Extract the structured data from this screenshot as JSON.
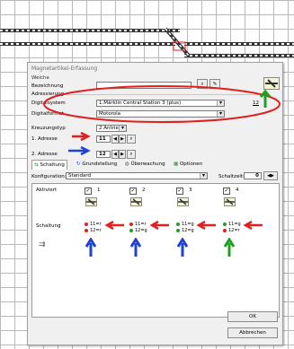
{
  "dialog": {
    "title": "Magnetartikel-Erfassung",
    "weiche_label": "Weiche",
    "bezeichnung_label": "Bezeichnung",
    "adressierung_label": "Adressierung",
    "digitalsystem_label": "Digitalsystem",
    "digitalsystem_value": "1.Märklin Central Station 3 (plus)",
    "digitalformat_label": "Digitalformat",
    "digitalformat_value": "Motorola",
    "kreuzungstyp_label": "Kreuzungstyp",
    "kreuzungstyp_value": "2 Antriebe",
    "adresse1_label": "1. Adresse",
    "adresse1_value": "11",
    "adresse2_label": "2. Adresse",
    "adresse2_value": "12",
    "help_number": "12"
  },
  "tabs": [
    {
      "label": "Schaltung"
    },
    {
      "label": "Grundstellung"
    },
    {
      "label": "Überwachung"
    },
    {
      "label": "Optionen"
    }
  ],
  "config": {
    "konfiguration_label": "Konfiguration:",
    "konfiguration_value": "Standard",
    "schaltzeit_label": "Schaltzeit:",
    "schaltzeit_value": "0"
  },
  "panel": {
    "aktiviert_label": "Aktiviert",
    "schaltung_label": "Schaltung",
    "columns": [
      {
        "num": "1",
        "line1": "11=r",
        "line2": "12=r",
        "c1": "#e02020",
        "c2": "#e02020"
      },
      {
        "num": "2",
        "line1": "11=r",
        "line2": "12=g",
        "c1": "#e02020",
        "c2": "#20a020"
      },
      {
        "num": "3",
        "line1": "11=g",
        "line2": "12=g",
        "c1": "#20a020",
        "c2": "#20a020"
      },
      {
        "num": "4",
        "line1": "11=g",
        "line2": "12=r",
        "c1": "#20a020",
        "c2": "#e02020"
      }
    ]
  },
  "buttons": {
    "ok": "OK",
    "abbrechen": "Abbrechen"
  },
  "colors": {
    "annotation_red": "#e02020",
    "annotation_blue": "#2040d0",
    "annotation_green": "#20a020"
  }
}
